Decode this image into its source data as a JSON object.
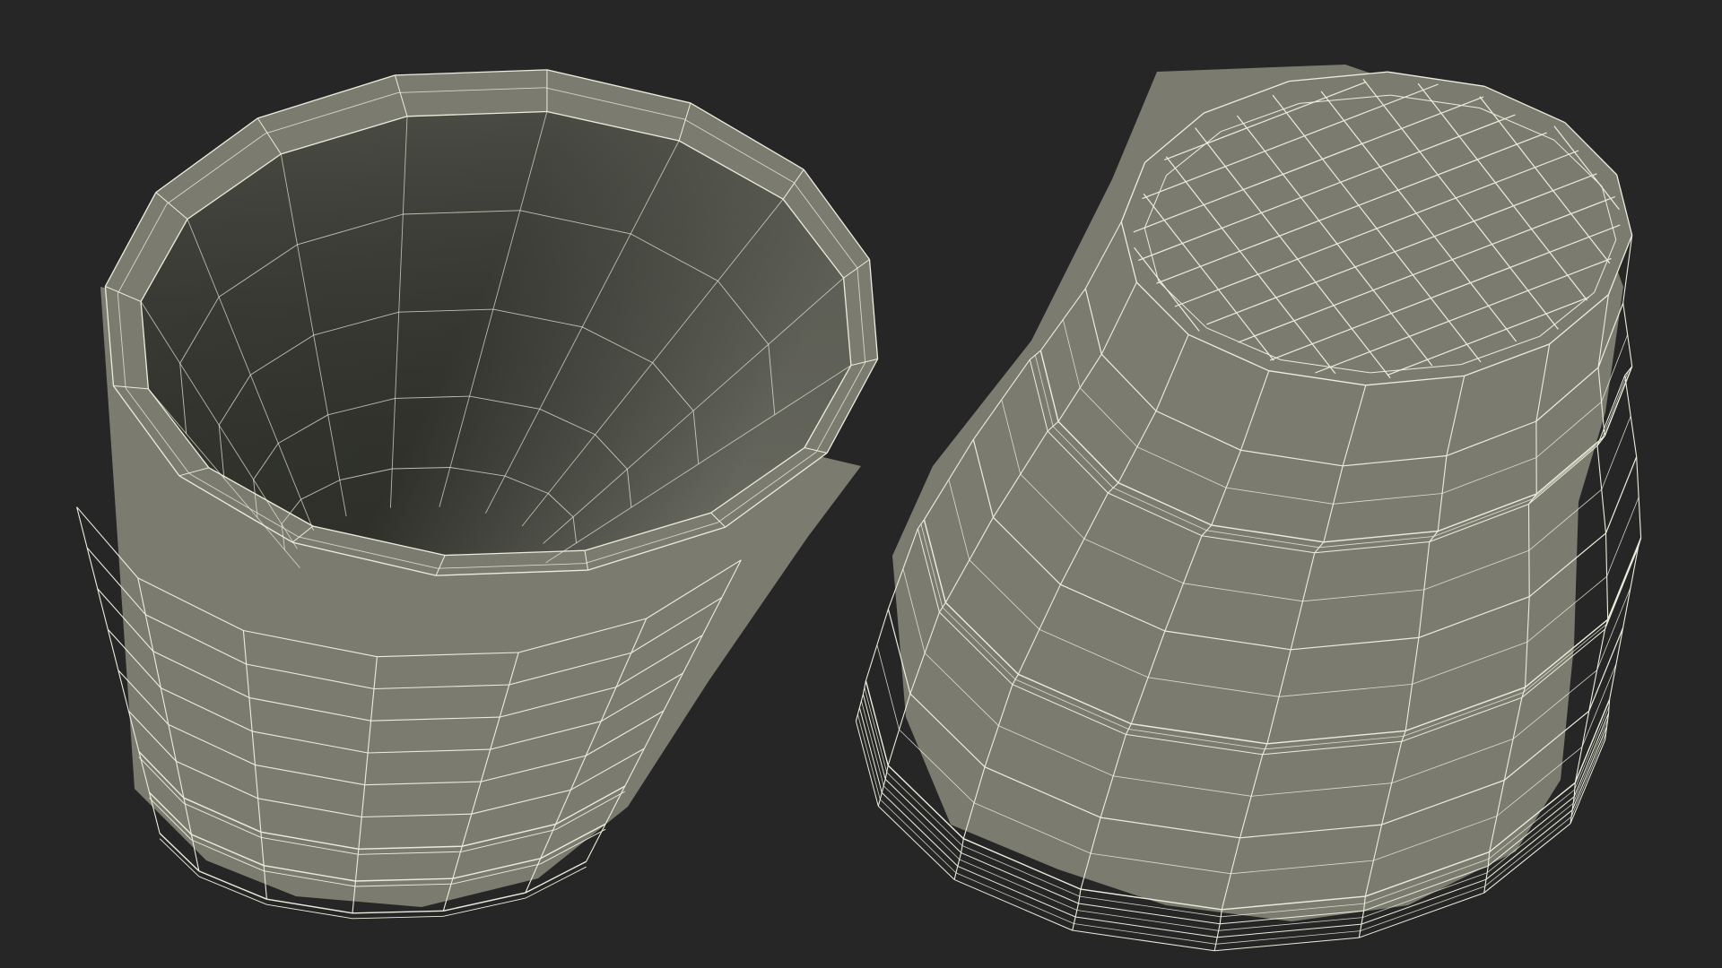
{
  "scene": {
    "background_color": "#262626",
    "mesh_fill_color": "#7b7c6f",
    "mesh_inner_dark_color": "#2e2f29",
    "mesh_inner_light_color": "#6f7066",
    "wire_color": "#eceedd",
    "objects": [
      {
        "name": "cup-open-top-wireframe",
        "view": "top-open"
      },
      {
        "name": "cup-bottom-wireframe",
        "view": "bottom"
      }
    ]
  }
}
